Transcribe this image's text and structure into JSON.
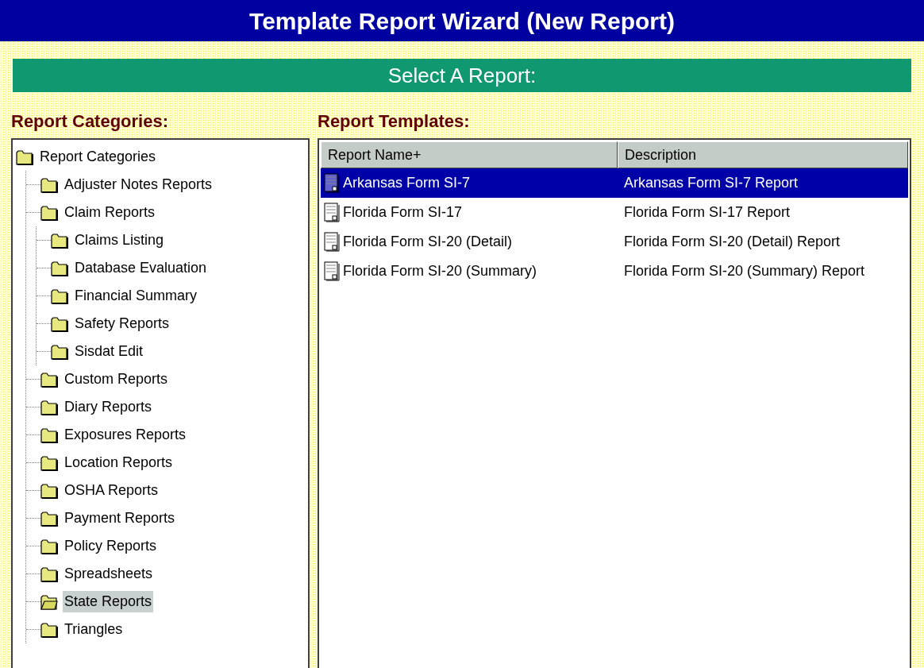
{
  "window": {
    "title": "Template Report Wizard (New Report)"
  },
  "section_bar": {
    "title": "Select A Report:"
  },
  "categories": {
    "heading": "Report Categories:",
    "tree": [
      {
        "label": "Report Categories",
        "selected": false,
        "children": [
          {
            "label": "Adjuster Notes Reports",
            "selected": false
          },
          {
            "label": "Claim Reports",
            "selected": false,
            "children": [
              {
                "label": "Claims Listing",
                "selected": false
              },
              {
                "label": "Database Evaluation",
                "selected": false
              },
              {
                "label": "Financial Summary",
                "selected": false
              },
              {
                "label": "Safety Reports",
                "selected": false
              },
              {
                "label": "Sisdat Edit",
                "selected": false
              }
            ]
          },
          {
            "label": "Custom Reports",
            "selected": false
          },
          {
            "label": "Diary Reports",
            "selected": false
          },
          {
            "label": "Exposures Reports",
            "selected": false
          },
          {
            "label": "Location Reports",
            "selected": false
          },
          {
            "label": "OSHA Reports",
            "selected": false
          },
          {
            "label": "Payment Reports",
            "selected": false
          },
          {
            "label": "Policy Reports",
            "selected": false
          },
          {
            "label": "Spreadsheets",
            "selected": false
          },
          {
            "label": "State Reports",
            "selected": true
          },
          {
            "label": "Triangles",
            "selected": false
          }
        ]
      }
    ]
  },
  "templates": {
    "heading": "Report Templates:",
    "columns": [
      "Report Name+",
      "Description"
    ],
    "rows": [
      {
        "name": "Arkansas Form SI-7",
        "description": "Arkansas Form SI-7 Report",
        "selected": true
      },
      {
        "name": "Florida Form SI-17",
        "description": "Florida Form SI-17 Report",
        "selected": false
      },
      {
        "name": "Florida Form SI-20 (Detail)",
        "description": "Florida Form SI-20 (Detail) Report",
        "selected": false
      },
      {
        "name": "Florida Form SI-20 (Summary)",
        "description": "Florida Form SI-20 (Summary) Report",
        "selected": false
      }
    ]
  }
}
